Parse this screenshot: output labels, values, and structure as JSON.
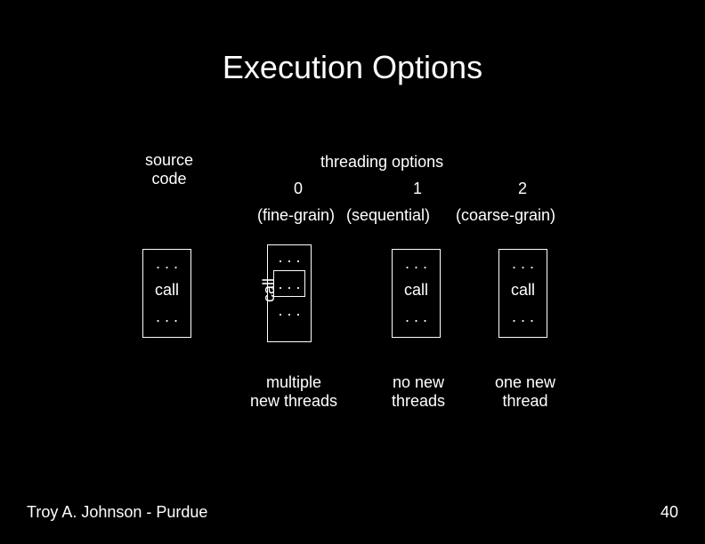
{
  "title": "Execution Options",
  "source_label_l1": "source",
  "source_label_l2": "code",
  "threading_label": "threading options",
  "columns": {
    "0": {
      "num": "0",
      "sub": "(fine-grain)",
      "caption_l1": "multiple",
      "caption_l2": "new threads"
    },
    "1": {
      "num": "1",
      "sub": "(sequential)",
      "caption_l1": "no new",
      "caption_l2": "threads"
    },
    "2": {
      "num": "2",
      "sub": "(coarse-grain)",
      "caption_l1": "one new",
      "caption_l2": "thread"
    }
  },
  "source_box": {
    "r1": ". . .",
    "r2": "call",
    "r3": ". . ."
  },
  "option0": {
    "r1": ". . .",
    "r2": ". . .",
    "r3": ". . .",
    "side": "call"
  },
  "option1": {
    "r1": ". . .",
    "r2": "call",
    "r3": ". . ."
  },
  "option2": {
    "r1": ". . .",
    "r2": "call",
    "r3": ". . ."
  },
  "footer": {
    "author": "Troy A. Johnson - Purdue",
    "page": "40"
  }
}
